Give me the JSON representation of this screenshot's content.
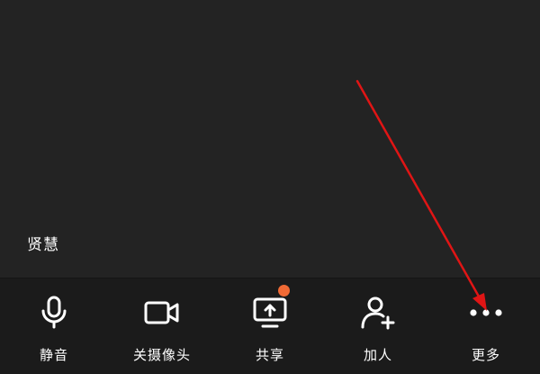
{
  "participant": {
    "name": "贤慧"
  },
  "toolbar": {
    "items": [
      {
        "label": "静音",
        "icon": "microphone-icon"
      },
      {
        "label": "关摄像头",
        "icon": "video-camera-icon"
      },
      {
        "label": "共享",
        "icon": "screen-share-icon",
        "badge": true
      },
      {
        "label": "加人",
        "icon": "add-user-icon"
      },
      {
        "label": "更多",
        "icon": "more-dots-icon"
      }
    ]
  },
  "colors": {
    "background": "#232323",
    "toolbar": "#1b1b1b",
    "badge": "#f06a35",
    "annotation": "#e01515"
  }
}
